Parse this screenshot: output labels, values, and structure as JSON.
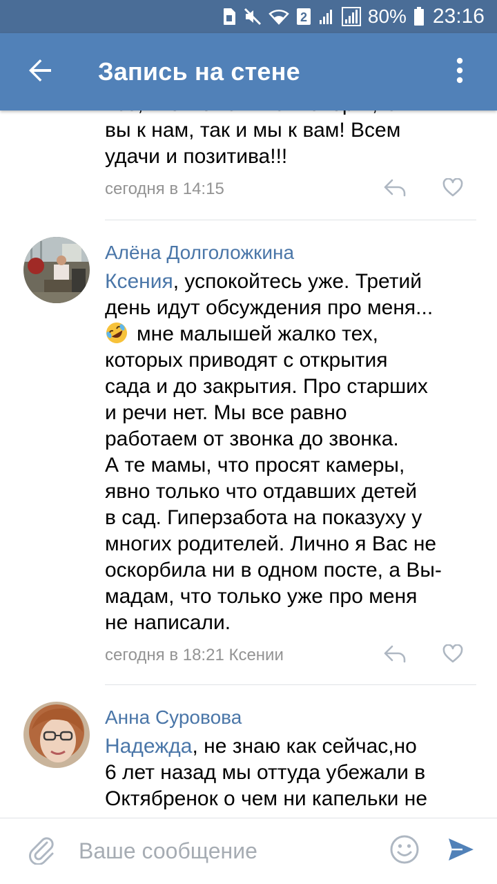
{
  "status_bar": {
    "battery_percent": "80%",
    "time": "23:16",
    "sim_badge": "2",
    "icons": [
      "sd-card-icon",
      "mute-icon",
      "wifi-icon",
      "sim-badge",
      "signal-icon",
      "signal-icon-2",
      "battery-icon"
    ]
  },
  "app_bar": {
    "title": "Запись на стене",
    "back_icon": "arrow-left-icon",
    "menu_icon": "more-vertical-icon"
  },
  "colors": {
    "status_bar_bg": "#4a6d97",
    "app_bar_bg": "#5181b8",
    "link": "#4a76a8",
    "meta_text": "#939393",
    "send_accent": "#5181b8"
  },
  "comments": [
    {
      "text_lines": [
        "все, что можем! Как говорят,как",
        "вы к нам, так и мы к вам! Всем",
        "удачи и позитива!!!"
      ],
      "meta": "сегодня в 14:15"
    },
    {
      "author": "Алёна Долголожкина",
      "mention": "Ксения",
      "text_intro": ", успокойтесь уже. Третий",
      "text_line2": "день идут обсуждения про меня...",
      "emoji_name": "rolling-on-floor-laughing-emoji",
      "text_line3": "мне малышей жалко тех,",
      "text_rest": [
        "которых приводят с открытия",
        "сада и до закрытия. Про старших",
        "и речи нет. Мы все равно",
        "работаем от звонка до звонка.",
        "А те мамы, что просят камеры,",
        "явно только что отдавших детей",
        "в сад. Гиперзабота на показуху у",
        "многих родителей. Лично я Вас не",
        "оскорбила ни в одном посте, а Вы-",
        "мадам, что только уже про меня",
        "не написали."
      ],
      "meta": "сегодня в 18:21 Ксении"
    },
    {
      "author": "Анна Суровова",
      "mention": "Надежда",
      "text_intro": ", не знаю как сейчас,но",
      "text_rest": [
        "6 лет назад мы оттуда убежали в",
        "Октябренок о чем ни капельки не"
      ]
    }
  ],
  "composer": {
    "placeholder": "Ваше сообщение",
    "attach_icon": "paperclip-icon",
    "emoji_icon": "smiley-icon",
    "send_icon": "send-icon"
  }
}
